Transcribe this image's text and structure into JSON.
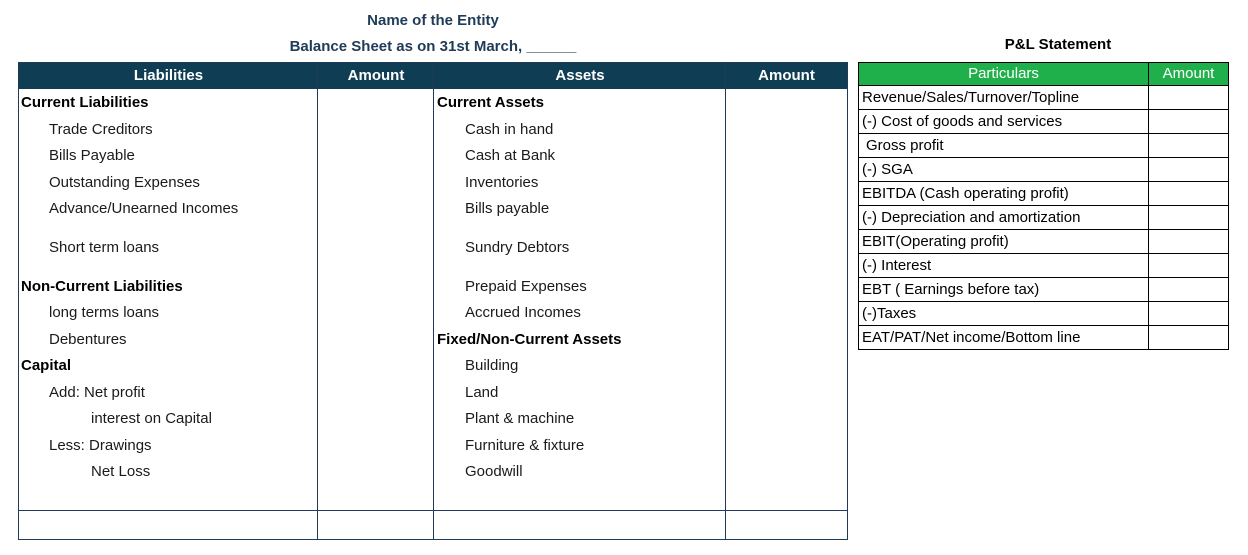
{
  "header": {
    "entity": "Name of the Entity",
    "balance_sheet_title": "Balance Sheet as on 31st March, ______"
  },
  "balance_sheet": {
    "columns": [
      "Liabilities",
      "Amount",
      "Assets",
      "Amount"
    ],
    "liabilities": [
      "Current Liabilities",
      "Trade Creditors",
      "Bills Payable",
      "Outstanding Expenses",
      "Advance/Unearned Incomes",
      "Short term loans",
      "Non-Current Liabilities",
      "long terms loans",
      "Debentures",
      "Capital",
      "Add:  Net profit",
      "interest on Capital",
      "Less:  Drawings",
      "Net Loss"
    ],
    "assets": [
      "Current Assets",
      "Cash in hand",
      "Cash at Bank",
      "Inventories",
      "Bills payable",
      "Sundry Debtors",
      "Prepaid Expenses",
      "Accrued Incomes",
      "Fixed/Non-Current Assets",
      "Building",
      "Land",
      "Plant & machine",
      "Furniture & fixture",
      "Goodwill"
    ]
  },
  "pl_statement": {
    "title": "P&L Statement",
    "columns": [
      "Particulars",
      "Amount"
    ],
    "rows": [
      "Revenue/Sales/Turnover/Topline",
      "(-) Cost of goods and services",
      " Gross profit",
      "(-) SGA",
      "EBITDA (Cash operating profit)",
      "(-) Depreciation and amortization",
      "EBIT(Operating profit)",
      "(-) Interest",
      "EBT ( Earnings before tax)",
      "(-)Taxes",
      "EAT/PAT/Net income/Bottom line"
    ]
  },
  "colors": {
    "bs_header": "#0f3d54",
    "title_text": "#1f3b57",
    "pl_header": "#20b04b"
  }
}
